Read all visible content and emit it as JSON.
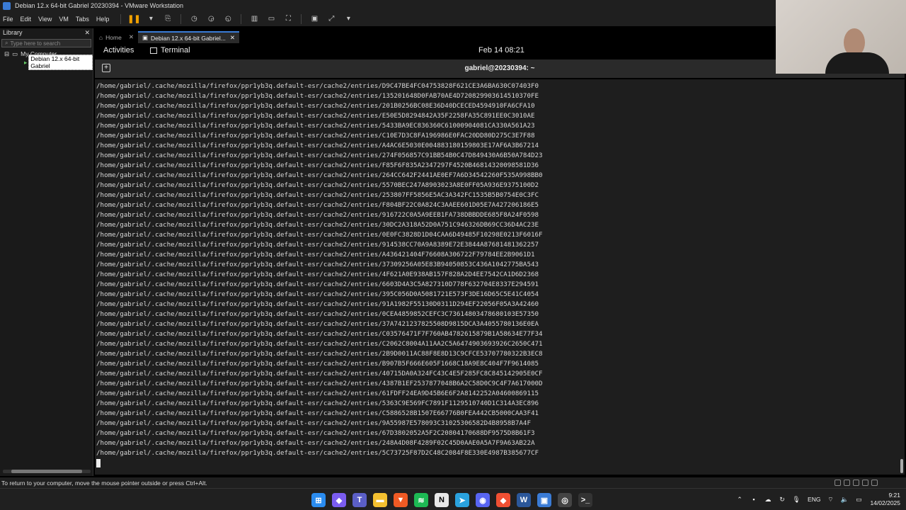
{
  "window": {
    "title": "Debian 12.x 64-bit Gabriel 20230394 - VMware Workstation"
  },
  "menu": [
    "File",
    "Edit",
    "View",
    "VM",
    "Tabs",
    "Help"
  ],
  "library": {
    "title": "Library",
    "search_placeholder": "Type here to search",
    "root": "My Computer",
    "vm": "Debian 12.x 64-bit Gabriel"
  },
  "tabs": [
    {
      "label": "Home"
    },
    {
      "label": "Debian 12.x 64-bit Gabriel..."
    }
  ],
  "gnome": {
    "activities": "Activities",
    "app": "Terminal",
    "clock": "Feb 14  08:21"
  },
  "terminal": {
    "title": "gabriel@20230394: ~",
    "lines": [
      "/home/gabriel/.cache/mozilla/firefox/ppr1yb3q.default-esr/cache2/entries/D9C47BE4FC04753828F621CE3A6BA630C07403F0",
      "/home/gabriel/.cache/mozilla/firefox/ppr1yb3q.default-esr/cache2/entries/135201648D0FAB70AE4D720829903614510370FE",
      "/home/gabriel/.cache/mozilla/firefox/ppr1yb3q.default-esr/cache2/entries/201B0256BC08E36D40DCECED4594910FA6CFA10",
      "/home/gabriel/.cache/mozilla/firefox/ppr1yb3q.default-esr/cache2/entries/E50E5D8294842A35F2258FA35C891EE0C3010AE",
      "/home/gabriel/.cache/mozilla/firefox/ppr1yb3q.default-esr/cache2/entries/5433BA9EC836360C61000904081CA330A561A23",
      "/home/gabriel/.cache/mozilla/firefox/ppr1yb3q.default-esr/cache2/entries/C10E7D3C8FA196986E0FAC20DD80D275C3E7F88",
      "/home/gabriel/.cache/mozilla/firefox/ppr1yb3q.default-esr/cache2/entries/A4AC6E5030E004883180159803E17AF6A3B67214",
      "/home/gabriel/.cache/mozilla/firefox/ppr1yb3q.default-esr/cache2/entries/274F056857C91BB54B0C47D849430A6B50A784D23",
      "/home/gabriel/.cache/mozilla/firefox/ppr1yb3q.default-esr/cache2/entries/F85F6F835A2347297F4520B46814320098581D36",
      "/home/gabriel/.cache/mozilla/firefox/ppr1yb3q.default-esr/cache2/entries/264CC642F2441AE0EF7A6D34542260F535A998BB0",
      "/home/gabriel/.cache/mozilla/firefox/ppr1yb3q.default-esr/cache2/entries/5570BEC247A8903023A8E0FF05A936E9375100D2",
      "/home/gabriel/.cache/mozilla/firefox/ppr1yb3q.default-esr/cache2/entries/253807FF5856E5AC3A342FC1535B5B0754E0C3FC",
      "/home/gabriel/.cache/mozilla/firefox/ppr1yb3q.default-esr/cache2/entries/F804BF22C0A824C3AAEE601D05E7A427206186E5",
      "/home/gabriel/.cache/mozilla/firefox/ppr1yb3q.default-esr/cache2/entries/916722C0A5A9EEB1FA738DBBDDE685F8A24F0598",
      "/home/gabriel/.cache/mozilla/firefox/ppr1yb3q.default-esr/cache2/entries/30DC2A318A52D0A751C946326DB69CC36D4AC23E",
      "/home/gabriel/.cache/mozilla/firefox/ppr1yb3q.default-esr/cache2/entries/0E0FC3828D1D04CAA6D49485F10298E0213F6016F",
      "/home/gabriel/.cache/mozilla/firefox/ppr1yb3q.default-esr/cache2/entries/914538CC70A9A8389E72E3844A87681481362257",
      "/home/gabriel/.cache/mozilla/firefox/ppr1yb3q.default-esr/cache2/entries/A436421404F76608A306722F79784EE2B9061D1",
      "/home/gabriel/.cache/mozilla/firefox/ppr1yb3q.default-esr/cache2/entries/37309256A05E83B94050853C436A1042775BA543",
      "/home/gabriel/.cache/mozilla/firefox/ppr1yb3q.default-esr/cache2/entries/4F621A0E938AB157F828A2D4EE7542CA1D6D2368",
      "/home/gabriel/.cache/mozilla/firefox/ppr1yb3q.default-esr/cache2/entries/6603D4A3C5A827310D778F632704E8337E294591",
      "/home/gabriel/.cache/mozilla/firefox/ppr1yb3q.default-esr/cache2/entries/395C056D0A5081721E573F3DE16D65C5E41C4054",
      "/home/gabriel/.cache/mozilla/firefox/ppr1yb3q.default-esr/cache2/entries/91A1982F55130D0311D294EF22056F05A3A42460",
      "/home/gabriel/.cache/mozilla/firefox/ppr1yb3q.default-esr/cache2/entries/0CEA4859852CEFC3C73614803478680103E57350",
      "/home/gabriel/.cache/mozilla/firefox/ppr1yb3q.default-esr/cache2/entries/37A7421237825508D9815DCA3A4055780136E0EA",
      "/home/gabriel/.cache/mozilla/firefox/ppr1yb3q.default-esr/cache2/entries/C03576471F7F760AB4782615879B1A58634E77F34",
      "/home/gabriel/.cache/mozilla/firefox/ppr1yb3q.default-esr/cache2/entries/C2062C8004A11AA2C5A6474903693926C2650C471",
      "/home/gabriel/.cache/mozilla/firefox/ppr1yb3q.default-esr/cache2/entries/2B9D0011AC88F8E8D13C9CFCE53707780322B3EC8",
      "/home/gabriel/.cache/mozilla/firefox/ppr1yb3q.default-esr/cache2/entries/B907B5F666E605F1668C18A9E8C404F7F9614085",
      "/home/gabriel/.cache/mozilla/firefox/ppr1yb3q.default-esr/cache2/entries/40715DA0A324FC43C4E5F285FC8C845142905E0CF",
      "/home/gabriel/.cache/mozilla/firefox/ppr1yb3q.default-esr/cache2/entries/4387B1EF2537877048B6A2C58D0C9C4F7A617000D",
      "/home/gabriel/.cache/mozilla/firefox/ppr1yb3q.default-esr/cache2/entries/61FDFF24EA9D45B6E6F2A8142252A04600869115",
      "/home/gabriel/.cache/mozilla/firefox/ppr1yb3q.default-esr/cache2/entries/5363C9E569FC7891F1129510740D1C314A3EC896",
      "/home/gabriel/.cache/mozilla/firefox/ppr1yb3q.default-esr/cache2/entries/C5886528B1507E66776B0FEA442CB5000CAA3F41",
      "/home/gabriel/.cache/mozilla/firefox/ppr1yb3q.default-esr/cache2/entries/9A55987E578093C31025306582D4B8958B7A4F",
      "/home/gabriel/.cache/mozilla/firefox/ppr1yb3q.default-esr/cache2/entries/67D3802052A5F2C20804170688DF9575D8B61F3",
      "/home/gabriel/.cache/mozilla/firefox/ppr1yb3q.default-esr/cache2/entries/248A4D08F4289F02C45D0AAE0A5A7F9A63AB22A",
      "/home/gabriel/.cache/mozilla/firefox/ppr1yb3q.default-esr/cache2/entries/5C73725F87D2C48C2084F8E330E4987B385677CF"
    ]
  },
  "status": {
    "text": "To return to your computer, move the mouse pointer outside or press Ctrl+Alt."
  },
  "taskbar": {
    "apps": [
      "windows-start",
      "copilot",
      "teams",
      "file-explorer",
      "brave",
      "spotify",
      "notion",
      "telegram",
      "discord",
      "git",
      "word",
      "vmware",
      "obs",
      "terminal"
    ],
    "lang": "ENG",
    "time": "9:21",
    "date": "14/02/2025"
  },
  "colors": {
    "accent": "#3a7bd5",
    "pause": "#f0a000"
  }
}
